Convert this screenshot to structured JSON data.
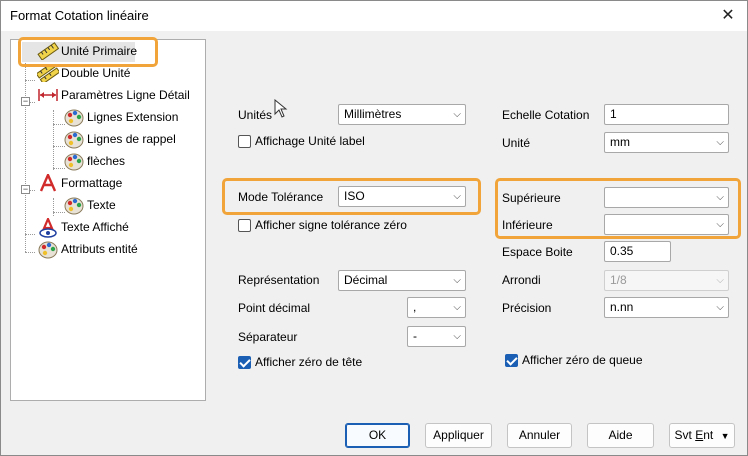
{
  "window": {
    "title": "Format Cotation linéaire",
    "close_glyph": "✕"
  },
  "tree": {
    "items": [
      {
        "label": "Unité Primaire",
        "icon": "ruler-icon",
        "selected": true
      },
      {
        "label": "Double Unité",
        "icon": "double-ruler-icon"
      },
      {
        "label": "Paramètres Ligne Détail",
        "icon": "dimension-line-icon"
      },
      {
        "label": "Lignes Extension",
        "icon": "palette-icon"
      },
      {
        "label": "Lignes de rappel",
        "icon": "palette-icon"
      },
      {
        "label": "flèches",
        "icon": "palette-icon"
      },
      {
        "label": "Formattage",
        "icon": "letter-a-icon"
      },
      {
        "label": "Texte",
        "icon": "palette-icon"
      },
      {
        "label": "Texte Affiché",
        "icon": "letter-a-eye-icon"
      },
      {
        "label": "Attributs entité",
        "icon": "palette-icon"
      }
    ]
  },
  "form": {
    "units_label": "Unités",
    "units_value": "Millimètres",
    "show_unit_label": "Affichage Unité label",
    "scale_label": "Echelle Cotation",
    "scale_value": "1",
    "unit_label": "Unité",
    "unit_value": "mm",
    "tolerance_mode_label": "Mode Tolérance",
    "tolerance_mode_value": "ISO",
    "upper_label": "Supérieure",
    "upper_value": "",
    "lower_label": "Inférieure",
    "lower_value": "",
    "show_zero_tol_label": "Afficher signe tolérance zéro",
    "box_spacing_label": "Espace Boite",
    "box_spacing_value": "0.35",
    "representation_label": "Représentation",
    "representation_value": "Décimal",
    "rounding_label": "Arrondi",
    "rounding_value": "1/8",
    "decimal_point_label": "Point décimal",
    "decimal_point_value": ",",
    "precision_label": "Précision",
    "precision_value": "n.nn",
    "separator_label": "Séparateur",
    "separator_value": "-",
    "leading_zero_label": "Afficher zéro de tête",
    "trailing_zero_label": "Afficher zéro de queue"
  },
  "buttons": {
    "ok": "OK",
    "apply": "Appliquer",
    "cancel": "Annuler",
    "help": "Aide",
    "next_prefix": "Svt ",
    "next_underlined": "E",
    "next_suffix": "nt"
  },
  "colors": {
    "highlight": "#f0a43a",
    "accent": "#1a5fb4"
  }
}
